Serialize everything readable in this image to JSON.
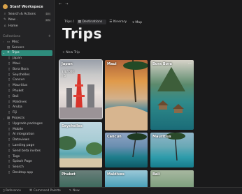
{
  "workspace": {
    "name": "Stanf Workspace"
  },
  "sidebar": {
    "top": [
      {
        "label": "Search & Actions",
        "icon": "search-icon",
        "kbd": "⌘K"
      },
      {
        "label": "New .",
        "icon": "new-icon",
        "kbd": "⌘N"
      },
      {
        "label": "Home",
        "icon": "home-icon"
      }
    ],
    "collections_label": "Collections",
    "misc": "Misc",
    "servers": "Servers",
    "trips": "Trips",
    "trip_items": [
      "Japan",
      "Maui",
      "Bora Bora",
      "Seychelles",
      "Cancun",
      "Mauritius",
      "Phuket",
      "Bali",
      "Maldives",
      "Aruba",
      "Fiji"
    ],
    "projects": "Projects",
    "project_items": [
      "Upgrade packages",
      "Mobile",
      "AI integration",
      "Dataviews",
      "Landing page",
      "Send beta invites",
      "Tags",
      "Splash Page",
      "Search",
      "Desktop app"
    ]
  },
  "breadcrumb": {
    "root": "Trips /",
    "view1": "Destinations",
    "view2": "Itinerary",
    "view3": "Map"
  },
  "page": {
    "title": "Trips",
    "new_label": "+ New Trip"
  },
  "cards": [
    {
      "name": "Japan",
      "price": "$2,000",
      "extra": "5"
    },
    {
      "name": "Maui"
    },
    {
      "name": "Bora Bora"
    },
    {
      "name": "Seychelles"
    },
    {
      "name": "Cancun"
    },
    {
      "name": "Mauritius"
    },
    {
      "name": "Phuket"
    },
    {
      "name": "Maldives"
    },
    {
      "name": "Bali"
    }
  ],
  "statusbar": {
    "reference": "Reference",
    "command": "Command Palette",
    "new": "New."
  }
}
